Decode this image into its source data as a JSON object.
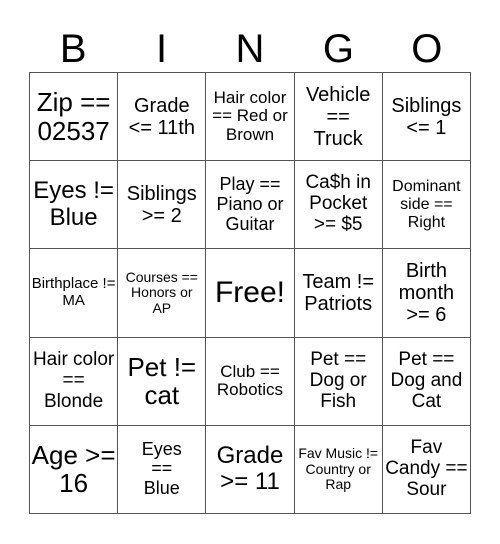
{
  "header": {
    "letters": [
      "B",
      "I",
      "N",
      "G",
      "O"
    ]
  },
  "cells": [
    [
      "Zip == 02537",
      "Grade <= 11th",
      "Hair color == Red or Brown",
      "Vehicle == Truck",
      "Siblings <= 1"
    ],
    [
      "Eyes != Blue",
      "Siblings >= 2",
      "Play == Piano or Guitar",
      "Ca$h in Pocket >= $5",
      "Dominant side == Right"
    ],
    [
      "Birthplace != MA",
      "Courses == Honors or AP",
      "Free!",
      "Team != Patriots",
      "Birth month >= 6"
    ],
    [
      "Hair color == Blonde",
      "Pet != cat",
      "Club == Robotics",
      "Pet == Dog or Fish",
      "Pet == Dog and Cat"
    ],
    [
      "Age >= 16",
      "Eyes == Blue",
      "Grade >= 11",
      "Fav Music != Country or Rap",
      "Fav Candy == Sour"
    ]
  ]
}
